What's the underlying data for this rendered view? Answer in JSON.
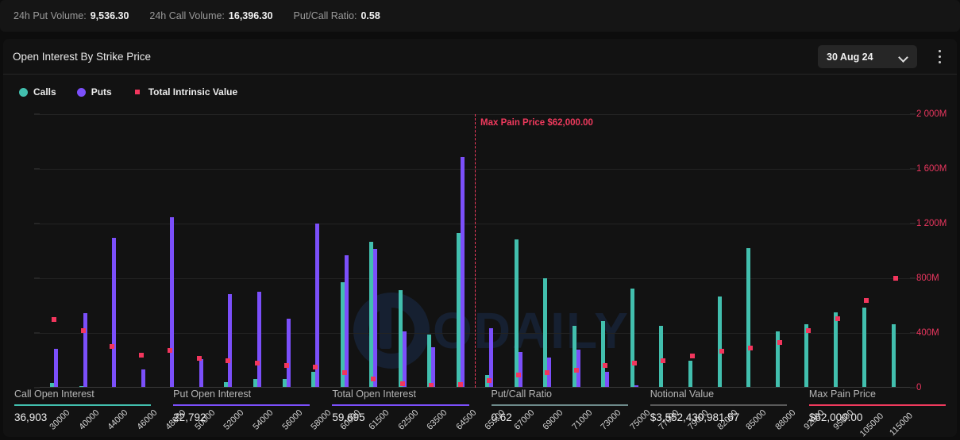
{
  "volume_bar": {
    "items": [
      {
        "label": "24h Put Volume:",
        "value": "9,536.30"
      },
      {
        "label": "24h Call Volume:",
        "value": "16,396.30"
      },
      {
        "label": "Put/Call Ratio:",
        "value": "0.58"
      }
    ]
  },
  "panel": {
    "title": "Open Interest By Strike Price",
    "date_selected": "30 Aug 24",
    "menu_icon": "kebab-menu-icon",
    "chevron_icon": "chevron-down-icon"
  },
  "legend": [
    {
      "label": "Calls",
      "color": "#42bfae",
      "marker": "circle"
    },
    {
      "label": "Puts",
      "color": "#7b4ffa",
      "marker": "circle"
    },
    {
      "label": "Total Intrinsic Value",
      "color": "#f2365d",
      "marker": "square"
    }
  ],
  "annotation": {
    "max_pain_label": "Max Pain Price $62,000.00",
    "max_pain_strike": "62000",
    "color": "#ef3a5d"
  },
  "stats": [
    {
      "label": "Call Open Interest",
      "value": "36,903",
      "color": "#42bfae"
    },
    {
      "label": "Put Open Interest",
      "value": "22,792",
      "color": "#7b4ffa"
    },
    {
      "label": "Total Open Interest",
      "value": "59,695",
      "color": "#7b4ffa"
    },
    {
      "label": "Put/Call Ratio",
      "value": "0.62",
      "color": "#6d8a8a"
    },
    {
      "label": "Notional Value",
      "value": "$3,552,430,981.57",
      "color": "#5a5a5a"
    },
    {
      "label": "Max Pain Price",
      "value": "$62,000.00",
      "color": "#ef3a5d"
    }
  ],
  "watermark": {
    "text": "ODAILY"
  },
  "chart_data": {
    "type": "bar",
    "title": "Open Interest By Strike Price",
    "xlabel": "",
    "ylabel": "Open Interest",
    "y2label": "Total Intrinsic Value",
    "ylim": [
      0,
      3000
    ],
    "yticks": [
      "0",
      "600",
      "1200",
      "1800",
      "2400",
      "3000"
    ],
    "y2lim": [
      0,
      2000
    ],
    "y2ticks": [
      "0",
      "400M",
      "800M",
      "1 200M",
      "1 600M",
      "2 000M"
    ],
    "grid": true,
    "legend_position": "top-left",
    "categories": [
      "30000",
      "40000",
      "44000",
      "46000",
      "48000",
      "50000",
      "52000",
      "54000",
      "56000",
      "58000",
      "60000",
      "61500",
      "62500",
      "63500",
      "64500",
      "65500",
      "67000",
      "69000",
      "71000",
      "73000",
      "75000",
      "77000",
      "79000",
      "82000",
      "85000",
      "88000",
      "92000",
      "95000",
      "105000",
      "115000"
    ],
    "series": [
      {
        "name": "Calls",
        "color": "#42bfae",
        "values": [
          50,
          20,
          0,
          0,
          0,
          0,
          60,
          95,
          100,
          170,
          1160,
          1600,
          1070,
          580,
          1700,
          140,
          1630,
          1200,
          680,
          730,
          1090,
          680,
          300,
          1000,
          1530,
          620,
          700,
          830,
          880,
          700
        ]
      },
      {
        "name": "Puts",
        "color": "#7b4ffa",
        "values": [
          430,
          820,
          1640,
          200,
          1870,
          310,
          1030,
          1050,
          760,
          1800,
          1450,
          1520,
          620,
          440,
          2530,
          650,
          390,
          330,
          420,
          170,
          30,
          0,
          0,
          0,
          0,
          0,
          0,
          0,
          0,
          0
        ]
      }
    ],
    "intrinsic_value": {
      "name": "Total Intrinsic Value",
      "color": "#f2365d",
      "unit": "M",
      "values": [
        500,
        420,
        300,
        240,
        270,
        215,
        200,
        180,
        160,
        150,
        110,
        65,
        30,
        20,
        25,
        55,
        95,
        110,
        130,
        160,
        180,
        200,
        230,
        265,
        290,
        330,
        420,
        505,
        640,
        800
      ]
    }
  }
}
